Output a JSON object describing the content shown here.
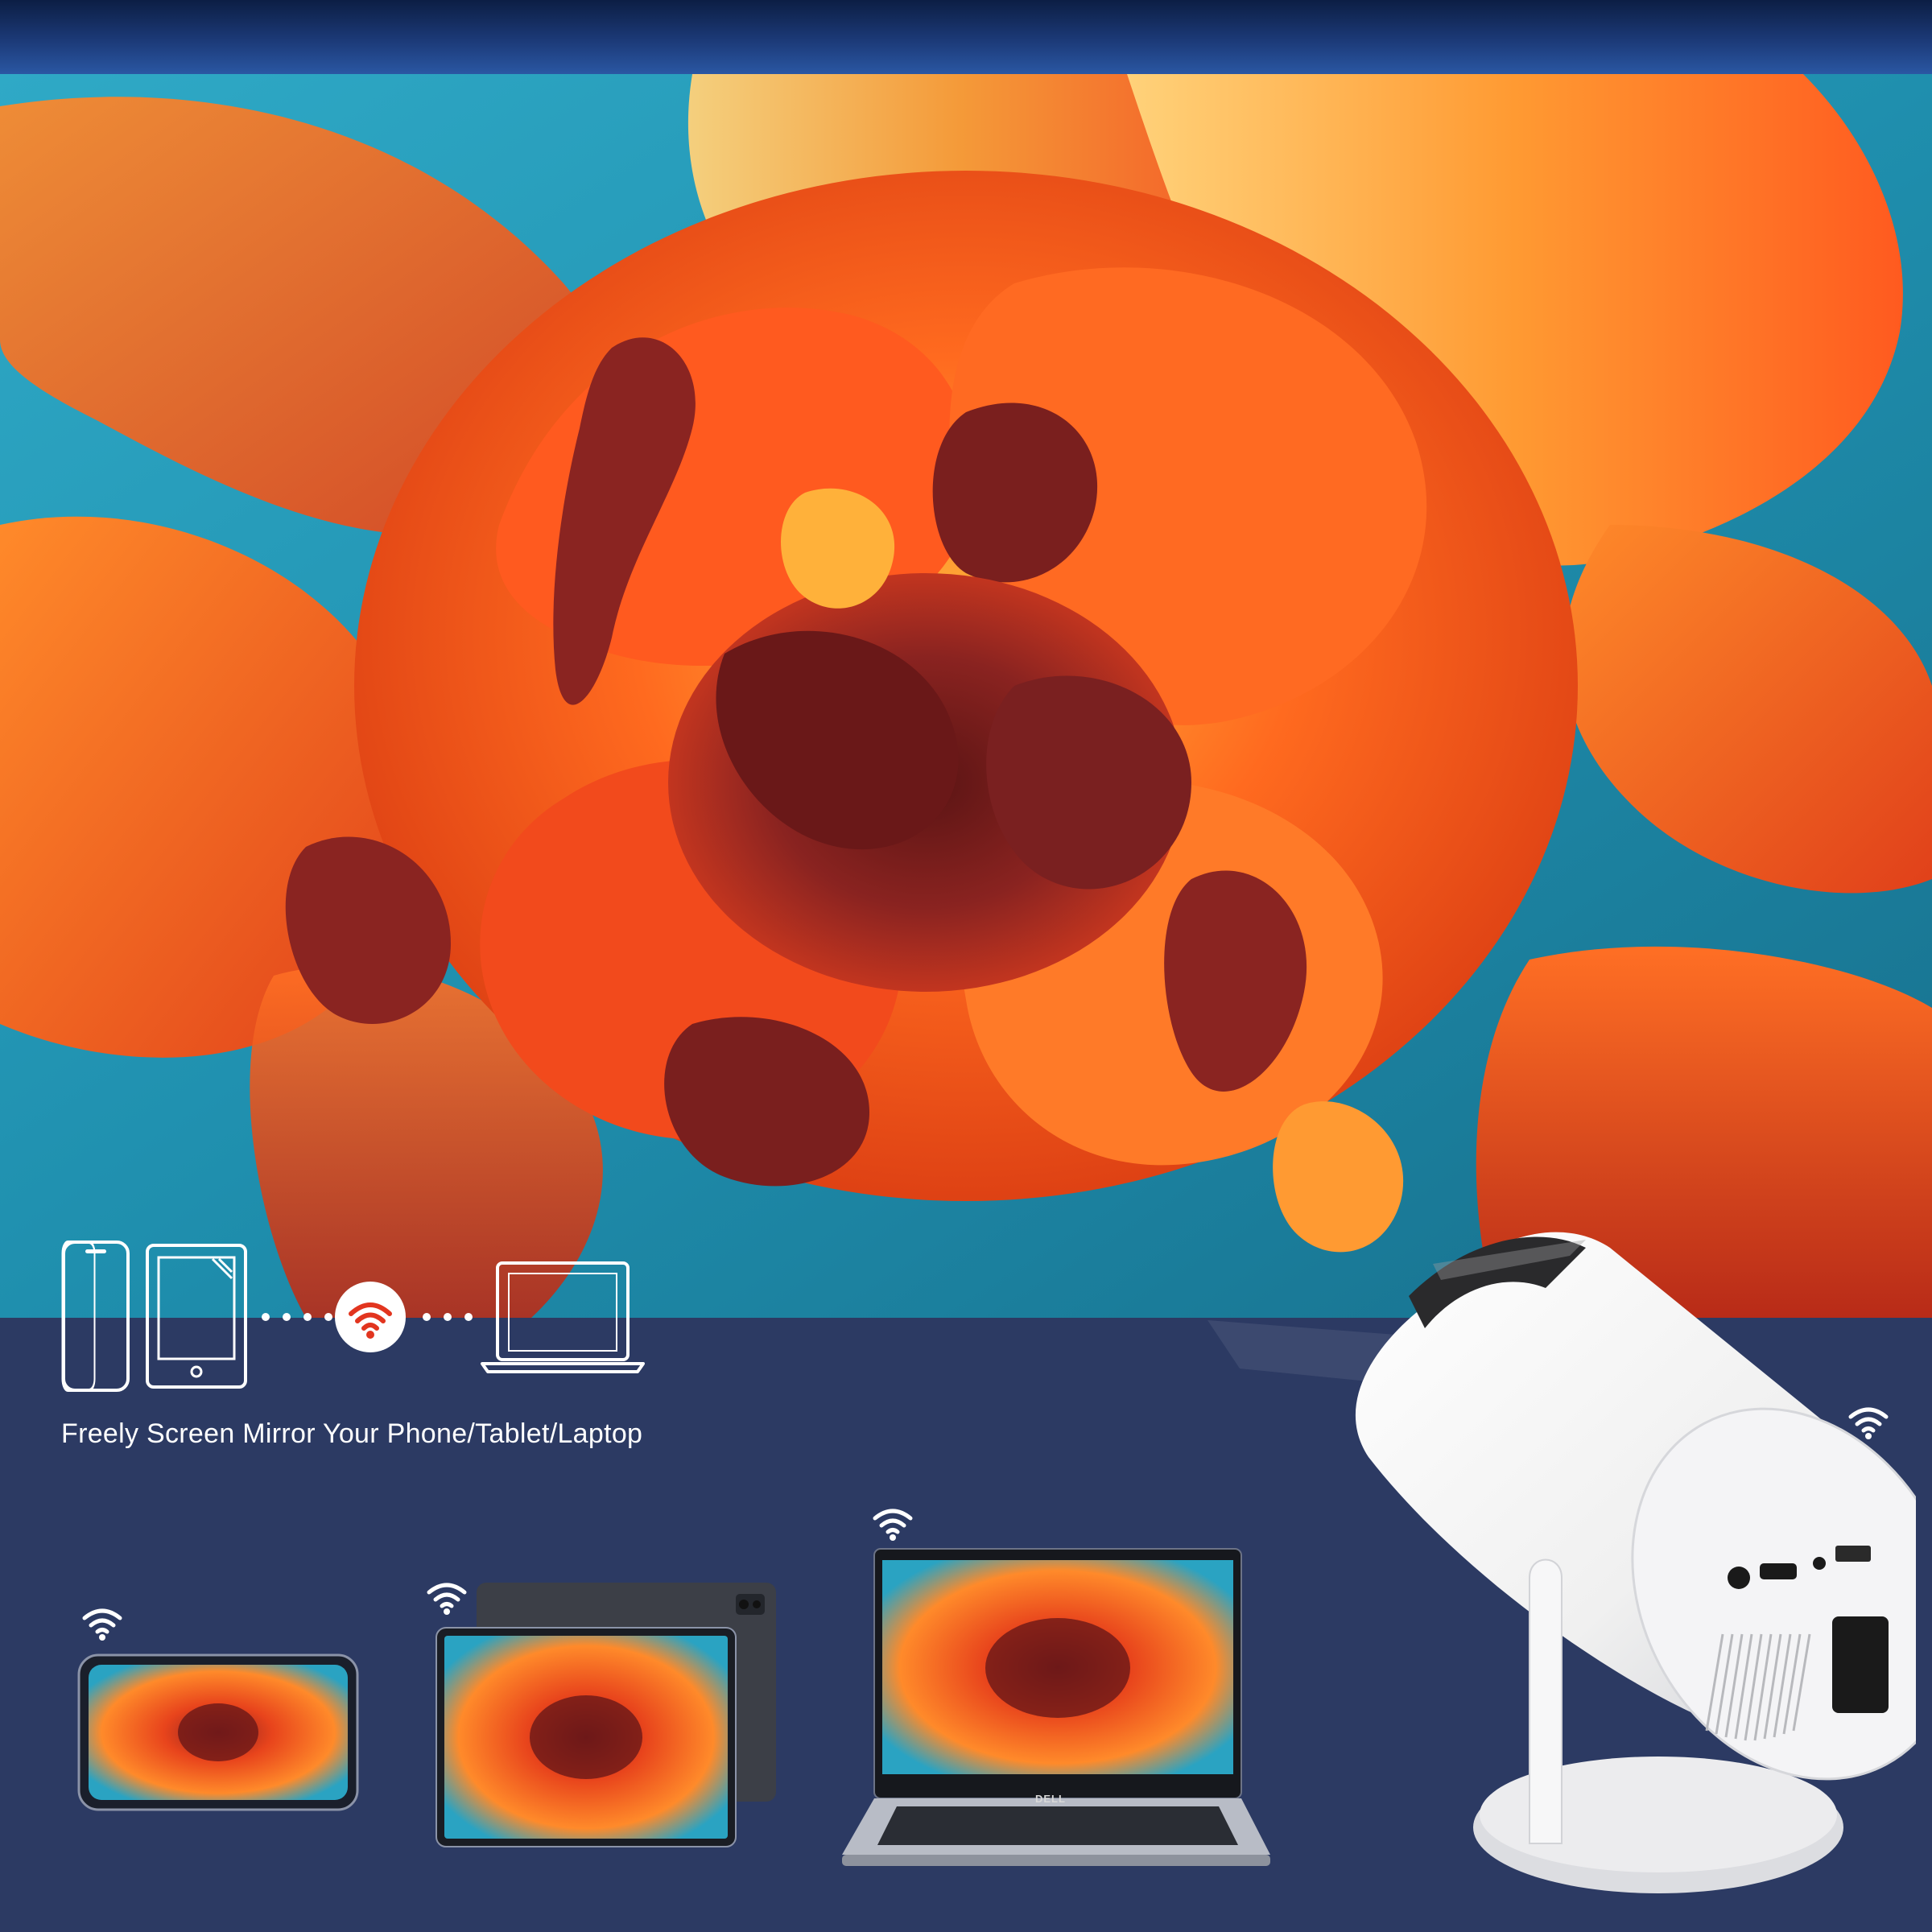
{
  "caption": "Freely Screen Mirror Your Phone/Tablet/Laptop",
  "laptop_brand": "DELL",
  "icons": [
    "phone-outline-icon",
    "tablet-outline-icon",
    "wifi-icon",
    "laptop-outline-icon"
  ],
  "colors": {
    "panel": "#2c3a63",
    "sky": "#2a8fb6",
    "petal_orange": "#ff5a1f",
    "petal_red": "#c8261b",
    "petal_dark": "#7a1f1e",
    "projector_body": "#f2f2f2"
  }
}
